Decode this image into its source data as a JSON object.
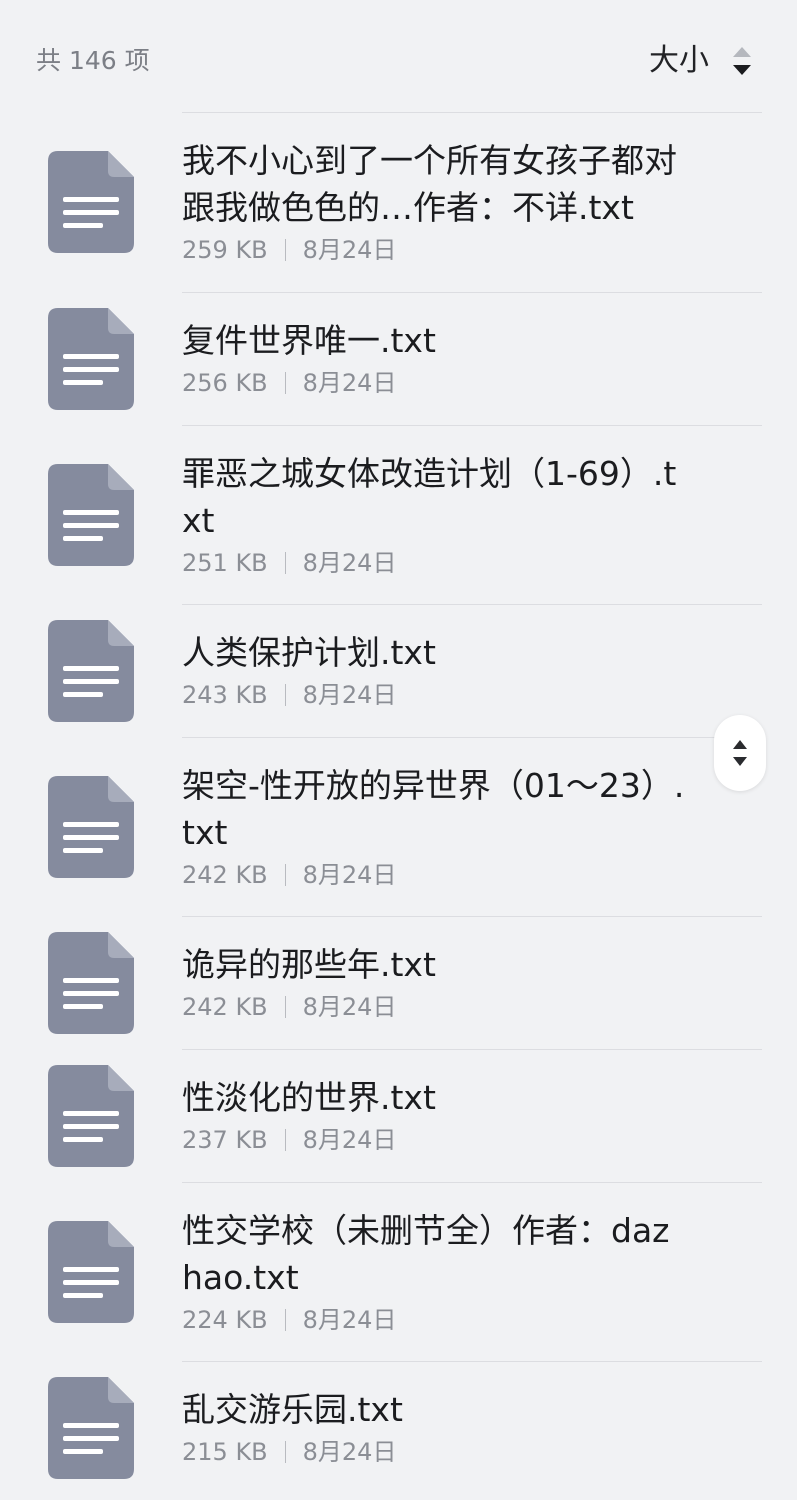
{
  "header": {
    "count_label": "共 146 项",
    "sort_label": "大小",
    "sort_icon": "sort-up-down-icon"
  },
  "colors": {
    "background": "#f1f2f4",
    "file_icon": "#858b9e",
    "divider": "#dcdde1",
    "text_primary": "#1b1c1f",
    "text_secondary": "#8b8e95"
  },
  "files": [
    {
      "name": "我不小心到了一个所有女孩子都对跟我做色色的…作者：不详.txt",
      "size": "259 KB",
      "date": "8月24日",
      "icon": "document-icon"
    },
    {
      "name": "复件世界唯一.txt",
      "size": "256 KB",
      "date": "8月24日",
      "icon": "document-icon"
    },
    {
      "name": "罪恶之城女体改造计划（1-69）.txt",
      "size": "251 KB",
      "date": "8月24日",
      "icon": "document-icon"
    },
    {
      "name": "人类保护计划.txt",
      "size": "243 KB",
      "date": "8月24日",
      "icon": "document-icon"
    },
    {
      "name": "架空-性开放的异世界（01～23）.txt",
      "size": "242 KB",
      "date": "8月24日",
      "icon": "document-icon"
    },
    {
      "name": "诡异的那些年.txt",
      "size": "242 KB",
      "date": "8月24日",
      "icon": "document-icon"
    },
    {
      "name": "性淡化的世界.txt",
      "size": "237 KB",
      "date": "8月24日",
      "icon": "document-icon"
    },
    {
      "name": "性交学校（未删节全）作者：dazhao.txt",
      "size": "224 KB",
      "date": "8月24日",
      "icon": "document-icon"
    },
    {
      "name": "乱交游乐园.txt",
      "size": "215 KB",
      "date": "8月24日",
      "icon": "document-icon"
    }
  ],
  "scroll_handle": {
    "icon": "scroll-up-down-icon"
  }
}
